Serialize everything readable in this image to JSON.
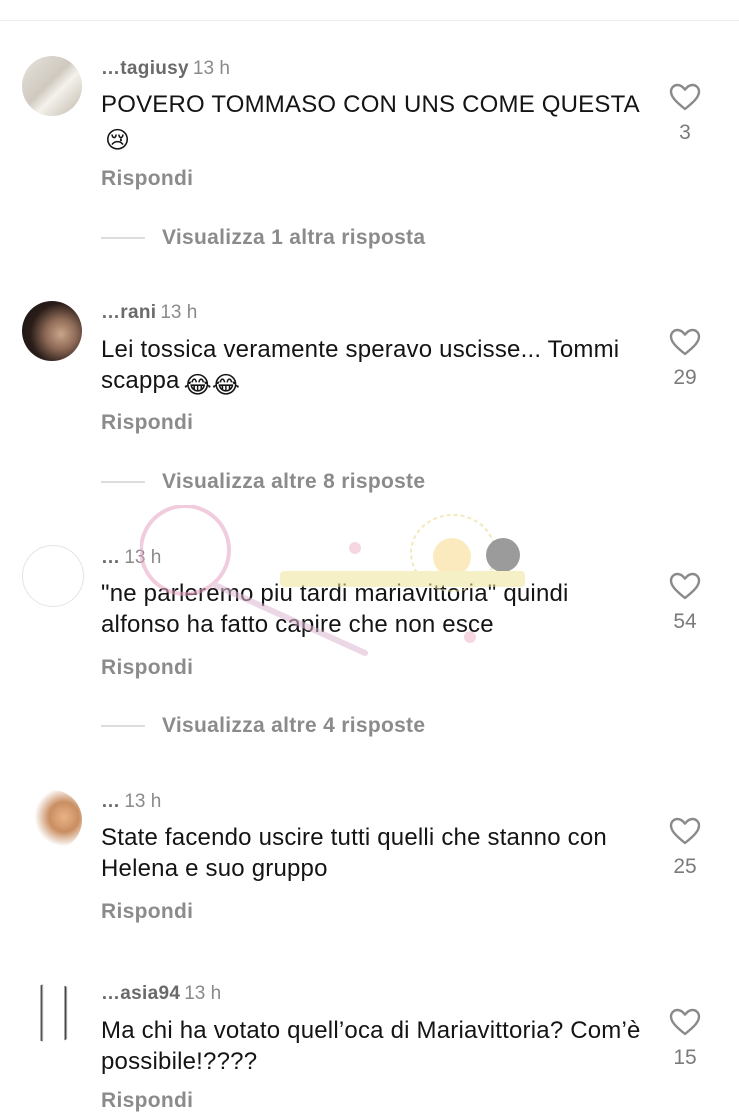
{
  "comments": [
    {
      "username": "…tagiusy",
      "time": "13 h",
      "text": "POVERO TOMMASO CON UNS COME QUESTA",
      "emoji": "😢",
      "likes": "3",
      "reply_label": "Rispondi",
      "more_replies": "Visualizza 1 altra risposta"
    },
    {
      "username": "…rani",
      "time": "13 h",
      "text": "Lei tossica veramente speravo uscisse... Tommi scappa",
      "emoji": "😂😂",
      "likes": "29",
      "reply_label": "Rispondi",
      "more_replies": "Visualizza altre 8 risposte"
    },
    {
      "username": "…",
      "time": "13 h",
      "text": "\"ne parleremo piu tardi mariavittoria\" quindi alfonso ha fatto capire che non esce",
      "likes": "54",
      "reply_label": "Rispondi",
      "more_replies": "Visualizza altre 4 risposte"
    },
    {
      "username": "…",
      "time": "13 h",
      "text": "State facendo uscire tutti quelli che stanno con  Helena e suo gruppo",
      "likes": "25",
      "reply_label": "Rispondi"
    },
    {
      "username": "…asia94",
      "time": "13 h",
      "text": "Ma chi ha votato quell’oca di Mariavittoria? Com’è possibile!????",
      "likes": "15",
      "reply_label": "Rispondi"
    }
  ],
  "icons": {
    "like": "heart-outline-icon"
  },
  "colors": {
    "secondary_text": "#8b8b8b",
    "primary_text": "#141414",
    "divider": "#dddddd"
  }
}
